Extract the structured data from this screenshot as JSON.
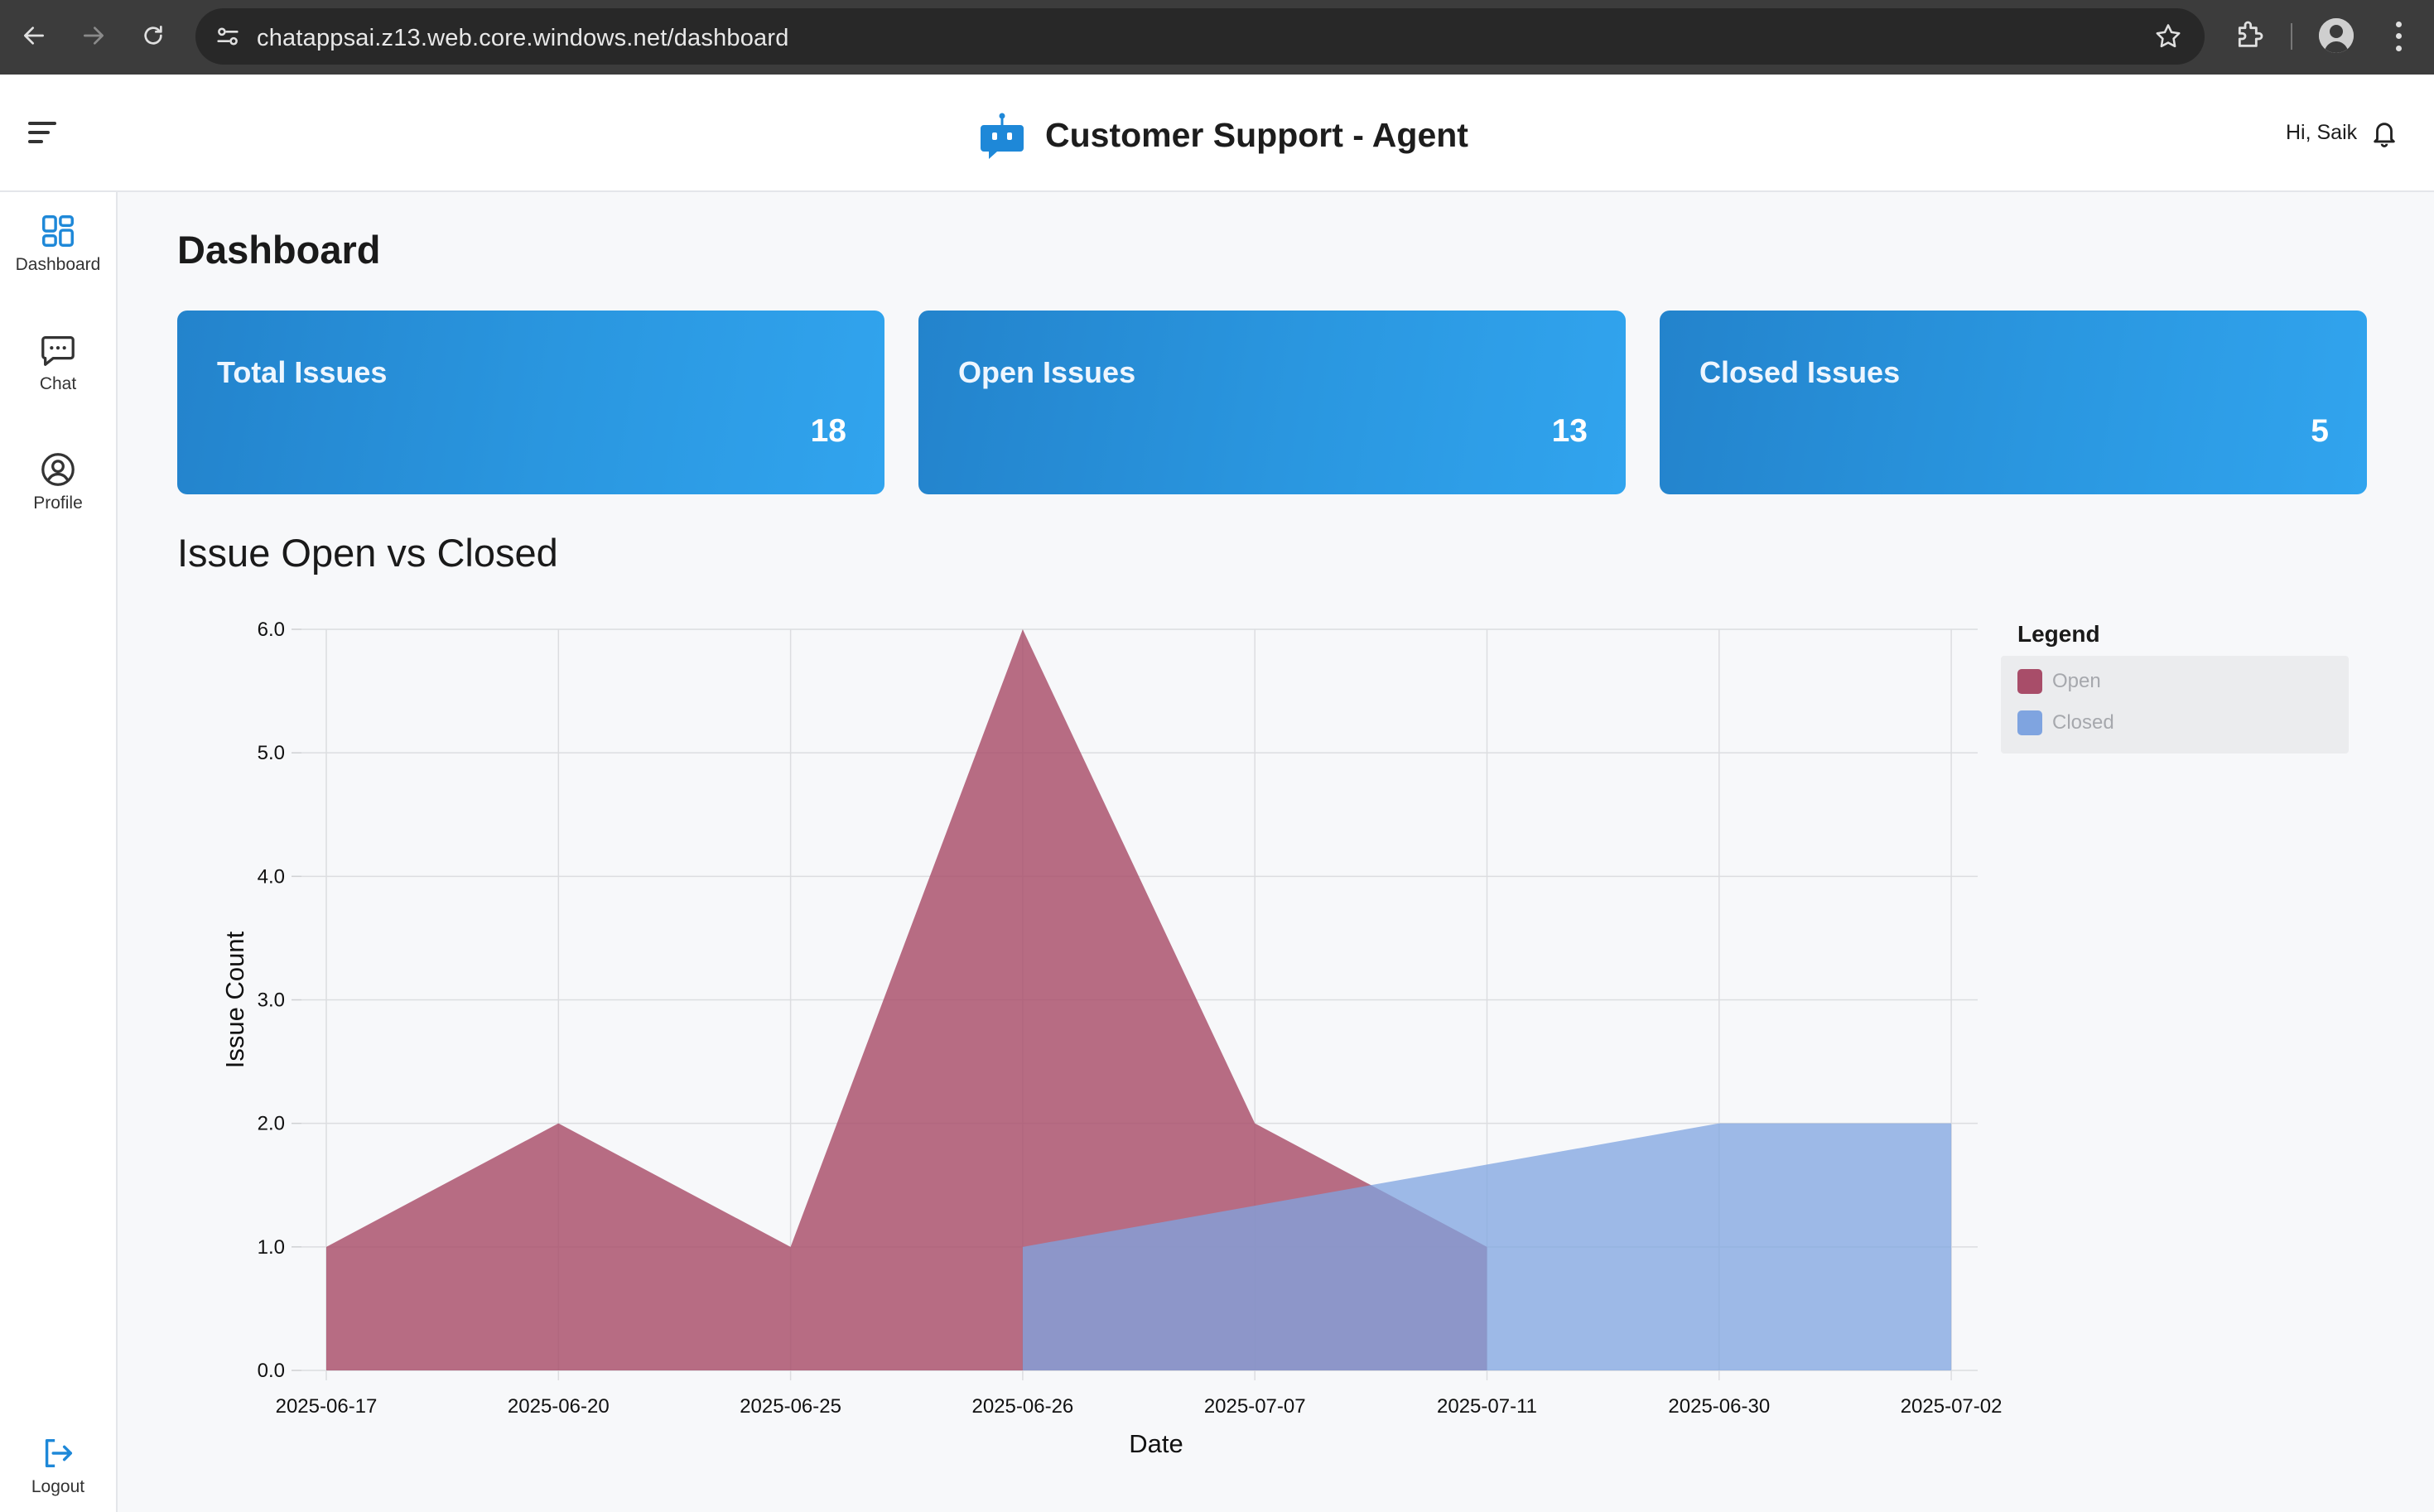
{
  "browser": {
    "url": "chatappsai.z13.web.core.windows.net/dashboard"
  },
  "header": {
    "app_title": "Customer Support - Agent",
    "greeting": "Hi, Saik"
  },
  "sidebar": {
    "items": [
      {
        "label": "Dashboard",
        "icon": "dashboard-icon",
        "active": true
      },
      {
        "label": "Chat",
        "icon": "chat-icon",
        "active": false
      },
      {
        "label": "Profile",
        "icon": "profile-icon",
        "active": false
      }
    ],
    "logout": {
      "label": "Logout",
      "icon": "logout-icon"
    }
  },
  "main": {
    "title": "Dashboard",
    "cards": [
      {
        "title": "Total Issues",
        "value": "18"
      },
      {
        "title": "Open Issues",
        "value": "13"
      },
      {
        "title": "Closed Issues",
        "value": "5"
      }
    ],
    "chart_heading": "Issue Open vs Closed"
  },
  "colors": {
    "accent": "#1e88d8",
    "open_series": "#a84d69",
    "closed_series": "#7fa4e0",
    "card_gradient_start": "#2383cc",
    "card_gradient_end": "#31a4ee"
  },
  "chart_data": {
    "type": "area",
    "title": "Issue Open vs Closed",
    "xlabel": "Date",
    "ylabel": "Issue Count",
    "categories": [
      "2025-06-17",
      "2025-06-20",
      "2025-06-25",
      "2025-06-26",
      "2025-07-07",
      "2025-07-11",
      "2025-06-30",
      "2025-07-02"
    ],
    "yticks": [
      "0.0",
      "1.0",
      "2.0",
      "3.0",
      "4.0",
      "5.0",
      "6.0"
    ],
    "ylim": [
      0,
      6
    ],
    "series": [
      {
        "name": "Open",
        "values": [
          1,
          2,
          1,
          6,
          2,
          1,
          null,
          null
        ]
      },
      {
        "name": "Closed",
        "values": [
          null,
          null,
          null,
          1,
          null,
          null,
          2,
          2
        ]
      }
    ],
    "grid": true,
    "legend": {
      "title": "Legend",
      "position": "right"
    }
  }
}
